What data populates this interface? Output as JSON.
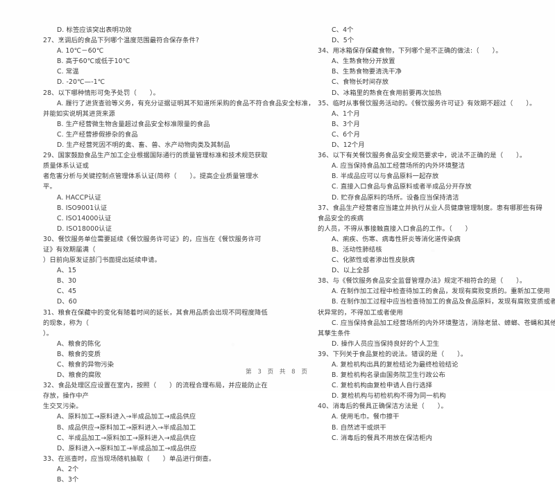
{
  "document": {
    "type": "scanned-exam-paper",
    "subject_hint": "食品安全管理人员考试（单项选择题）",
    "footer": "第 3 页 共 8 页"
  },
  "left_column": {
    "lines": [
      {
        "kind": "option",
        "text": "D. 标签应该突出表明功效"
      },
      {
        "kind": "question",
        "text": "27、烹调后的食品下列哪个温度范围最符合保存条件?"
      },
      {
        "kind": "option",
        "text": "A. 10℃－60℃"
      },
      {
        "kind": "option",
        "text": "B. 高于60℃或低于10℃"
      },
      {
        "kind": "option",
        "text": "C. 常温"
      },
      {
        "kind": "option",
        "text": "D. -20℃—-1℃"
      },
      {
        "kind": "question",
        "text": "28、以下哪种情形可免予处罚（　　）。"
      },
      {
        "kind": "option-indent",
        "text": "A. 履行了进货查验等义务，有充分证据证明其不知道所采购的食品不符合食品安全标准，"
      },
      {
        "kind": "cont",
        "text": "并能如实说明其进货来源"
      },
      {
        "kind": "option",
        "text": "B. 生产经营微生物含量超过食品安全标准限量的食品"
      },
      {
        "kind": "option",
        "text": "C. 生产经营掺假掺杂的食品"
      },
      {
        "kind": "option",
        "text": "D. 生产经营死因不明的禽、畜、兽、水产动物肉类及其制品"
      },
      {
        "kind": "question",
        "text": "29、国家鼓励食品生产加工企业根据国际通行的质量管理标准和技术规范获取质量体系认证或"
      },
      {
        "kind": "cont",
        "text": "者危害分析与关键控制点管理体系认证(简称（　　）。提高企业质量管理水平。"
      },
      {
        "kind": "option",
        "text": "A. HACCP认证"
      },
      {
        "kind": "option",
        "text": "B. ISO9001认证"
      },
      {
        "kind": "option",
        "text": "C. ISO14000认证"
      },
      {
        "kind": "option",
        "text": "D. ISO18000认证"
      },
      {
        "kind": "question",
        "text": "30、餐饮服务单位需要延续《餐饮服务许可证》的，应当在《餐饮服务许可证》有效期届满（"
      },
      {
        "kind": "cont",
        "text": "）日前向原发证部门书面提出延续申请。"
      },
      {
        "kind": "option",
        "text": "A、15"
      },
      {
        "kind": "option",
        "text": "B、30"
      },
      {
        "kind": "option",
        "text": "C、45"
      },
      {
        "kind": "option",
        "text": "D、60"
      },
      {
        "kind": "question",
        "text": "31、粮食在保藏中的变化有随着时间的延长，其食用品质会出现不同程度降低的现象，称为（"
      },
      {
        "kind": "cont",
        "text": "）。"
      },
      {
        "kind": "option",
        "text": "A、粮食的陈化"
      },
      {
        "kind": "option",
        "text": "B、粮食的变质"
      },
      {
        "kind": "option",
        "text": "C、粮食的异物污染"
      },
      {
        "kind": "option",
        "text": "D、粮食的腐败"
      },
      {
        "kind": "question",
        "text": "32、食品处理区应设置在室内，按照（　　）的流程合理布局，并应能防止在存放，操作中产"
      },
      {
        "kind": "cont",
        "text": "生交叉污染。"
      },
      {
        "kind": "option",
        "text": "A、原料加工→原料进入→半成品加工→成品供应"
      },
      {
        "kind": "option",
        "text": "B、成品供应→原料加工→原料进入→半成品加工"
      },
      {
        "kind": "option",
        "text": "C、半成品加工→原料加工→原料进入→成品供应"
      },
      {
        "kind": "option",
        "text": "D、原料进入→原料加工→半成品加工→成品供应"
      },
      {
        "kind": "question",
        "text": "33、在巡查时，应当现场随机抽取（　　）单品进行倒查。"
      },
      {
        "kind": "option",
        "text": "A、2个"
      },
      {
        "kind": "option",
        "text": "B、3个"
      }
    ]
  },
  "right_column": {
    "lines": [
      {
        "kind": "option",
        "text": "C、4个"
      },
      {
        "kind": "option",
        "text": "D、5个"
      },
      {
        "kind": "question",
        "text": "34、用冰箱保存保藏食物，下列哪个是不正确的做法:（　　）。"
      },
      {
        "kind": "option",
        "text": "A、生熟食物分开放置"
      },
      {
        "kind": "option",
        "text": "B、生熟食物要清洗干净"
      },
      {
        "kind": "option",
        "text": "C、食物长时间存放"
      },
      {
        "kind": "option",
        "text": "D、冰箱里的熟食在食用前要再次加热"
      },
      {
        "kind": "question",
        "text": "35、临时从事餐饮服务活动的。《餐饮服务许可证》有效期不超过（　　）。"
      },
      {
        "kind": "option",
        "text": "A、1个月"
      },
      {
        "kind": "option",
        "text": "B、3个月"
      },
      {
        "kind": "option",
        "text": "C、6个月"
      },
      {
        "kind": "option",
        "text": "D、12个月"
      },
      {
        "kind": "question",
        "text": "36、以下有关餐饮服务食品安全规范要求中，说法不正确的是（　　）。"
      },
      {
        "kind": "option",
        "text": "A. 应当保持食品加工经营场所的内外环境整洁"
      },
      {
        "kind": "option",
        "text": "B. 半成品应可以与食品原料一起存放"
      },
      {
        "kind": "option",
        "text": "C. 直接入口食品与食品原料或者半成品分开存放"
      },
      {
        "kind": "option",
        "text": "D. 贮存食品原料的场所。设备应当保持清洁"
      },
      {
        "kind": "question",
        "text": "37、食品生产经营者应当建立并执行从业人员健康管理制度。患有哪那些有碍食品安全的疾病"
      },
      {
        "kind": "cont",
        "text": "的人员，不得从事接触直接入口食品的工作。（　　）"
      },
      {
        "kind": "option",
        "text": "A、痢疾、伤寒、病毒性肝炎等消化道传染病"
      },
      {
        "kind": "option",
        "text": "B、活动性肺结核"
      },
      {
        "kind": "option",
        "text": "C、化脓性或者渗出性皮肤病"
      },
      {
        "kind": "option",
        "text": "D、以上全部"
      },
      {
        "kind": "question",
        "text": "38、与《餐饮服务食品安全监督管理办法》规定不相符合的是（　　）。"
      },
      {
        "kind": "option",
        "text": "A. 在制作加工过程中检查待加工的食品，发现有腐败变质的。重新加工使用"
      },
      {
        "kind": "option",
        "text": "B. 在制作加工过程中应当检查待加工的食品及食品原料，发现有腐败变质或者其他感官性"
      },
      {
        "kind": "cont",
        "text": "状异常的，不得加工或者使用"
      },
      {
        "kind": "option",
        "text": "C. 应当保持食品加工经营场所的内外环境整洁，消除老鼠、蟑螂、苍蝇和其他有害昆虫及"
      },
      {
        "kind": "cont",
        "text": "其孳生条件"
      },
      {
        "kind": "option",
        "text": "D. 操作人员应当保持良好的个人卫生"
      },
      {
        "kind": "question",
        "text": "39、下列关于食品复检的说法。错误的是（　　）。"
      },
      {
        "kind": "option",
        "text": "A. 复检机构出具的复检结论为最终检验结论"
      },
      {
        "kind": "option",
        "text": "B. 复检机构名录由国务院卫生行政公布"
      },
      {
        "kind": "option",
        "text": "C. 复检机构由复检申请人自行选择"
      },
      {
        "kind": "option",
        "text": "D. 复检机构与初检机构不得为同一机构"
      },
      {
        "kind": "question",
        "text": "40、消毒后的餐具正确保洁方法是（　　）。"
      },
      {
        "kind": "option",
        "text": "A. 使用毛巾。餐巾擦干"
      },
      {
        "kind": "option",
        "text": "B. 自然滤干或烘干"
      },
      {
        "kind": "option",
        "text": "C. 消毒后的餐具不用放在保洁柜内"
      }
    ]
  }
}
